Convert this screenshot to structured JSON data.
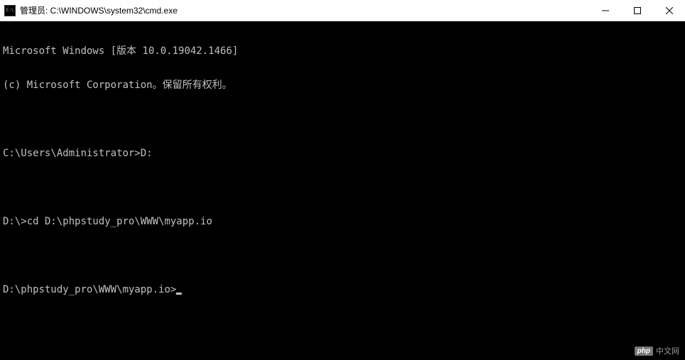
{
  "window": {
    "title": "管理员: C:\\WINDOWS\\system32\\cmd.exe"
  },
  "terminal": {
    "lines": [
      "Microsoft Windows [版本 10.0.19042.1466]",
      "(c) Microsoft Corporation。保留所有权利。",
      "",
      "C:\\Users\\Administrator>D:",
      "",
      "D:\\>cd D:\\phpstudy_pro\\WWW\\myapp.io",
      "",
      "D:\\phpstudy_pro\\WWW\\myapp.io>"
    ]
  },
  "watermark": {
    "badge": "php",
    "text": "中文网"
  }
}
